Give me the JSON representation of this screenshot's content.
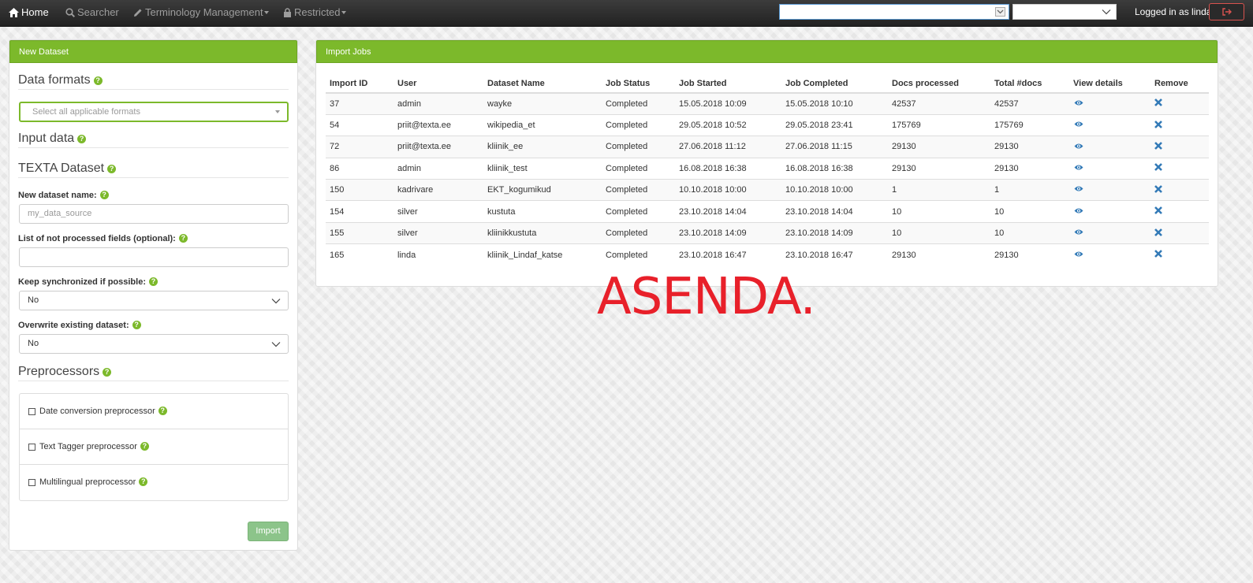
{
  "navbar": {
    "home": "Home",
    "searcher": "Searcher",
    "terminology": "Terminology Management",
    "restricted": "Restricted",
    "logged_in": "Logged in as linda."
  },
  "new_dataset": {
    "heading": "New Dataset",
    "data_formats_title": "Data formats",
    "formats_placeholder": "Select all applicable formats",
    "input_data_title": "Input data",
    "texta_dataset_title": "TEXTA Dataset",
    "new_dataset_name_label": "New dataset name:",
    "new_dataset_name_placeholder": "my_data_source",
    "not_processed_label": "List of not processed fields (optional):",
    "keep_sync_label": "Keep synchronized if possible:",
    "keep_sync_value": "No",
    "overwrite_label": "Overwrite existing dataset:",
    "overwrite_value": "No",
    "preprocessors_title": "Preprocessors",
    "preprocessors": [
      "Date conversion preprocessor",
      "Text Tagger preprocessor",
      "Multilingual preprocessor"
    ],
    "import_button": "Import"
  },
  "import_jobs": {
    "heading": "Import Jobs",
    "columns": [
      "Import ID",
      "User",
      "Dataset Name",
      "Job Status",
      "Job Started",
      "Job Completed",
      "Docs processed",
      "Total #docs",
      "View details",
      "Remove"
    ],
    "rows": [
      [
        "37",
        "admin",
        "wayke",
        "Completed",
        "15.05.2018 10:09",
        "15.05.2018 10:10",
        "42537",
        "42537"
      ],
      [
        "54",
        "priit@texta.ee",
        "wikipedia_et",
        "Completed",
        "29.05.2018 10:52",
        "29.05.2018 23:41",
        "175769",
        "175769"
      ],
      [
        "72",
        "priit@texta.ee",
        "kliinik_ee",
        "Completed",
        "27.06.2018 11:12",
        "27.06.2018 11:15",
        "29130",
        "29130"
      ],
      [
        "86",
        "admin",
        "kliinik_test",
        "Completed",
        "16.08.2018 16:38",
        "16.08.2018 16:38",
        "29130",
        "29130"
      ],
      [
        "150",
        "kadrivare",
        "EKT_kogumikud",
        "Completed",
        "10.10.2018 10:00",
        "10.10.2018 10:00",
        "1",
        "1"
      ],
      [
        "154",
        "silver",
        "kustuta",
        "Completed",
        "23.10.2018 14:04",
        "23.10.2018 14:04",
        "10",
        "10"
      ],
      [
        "155",
        "silver",
        "kliinikkustuta",
        "Completed",
        "23.10.2018 14:09",
        "23.10.2018 14:09",
        "10",
        "10"
      ],
      [
        "165",
        "linda",
        "kliinik_Lindaf_katse",
        "Completed",
        "23.10.2018 16:47",
        "23.10.2018 16:47",
        "29130",
        "29130"
      ]
    ]
  },
  "overlay_text": "ASENDA.",
  "colors": {
    "brand_green": "#7cb92b",
    "navbar": "#222222",
    "eye_icon": "#337ab7",
    "overlay_red": "#e8202a"
  },
  "icons": [
    "home-icon",
    "search-icon",
    "pencil-icon",
    "lock-icon",
    "logout-icon",
    "help-icon",
    "eye-icon",
    "remove-icon"
  ]
}
